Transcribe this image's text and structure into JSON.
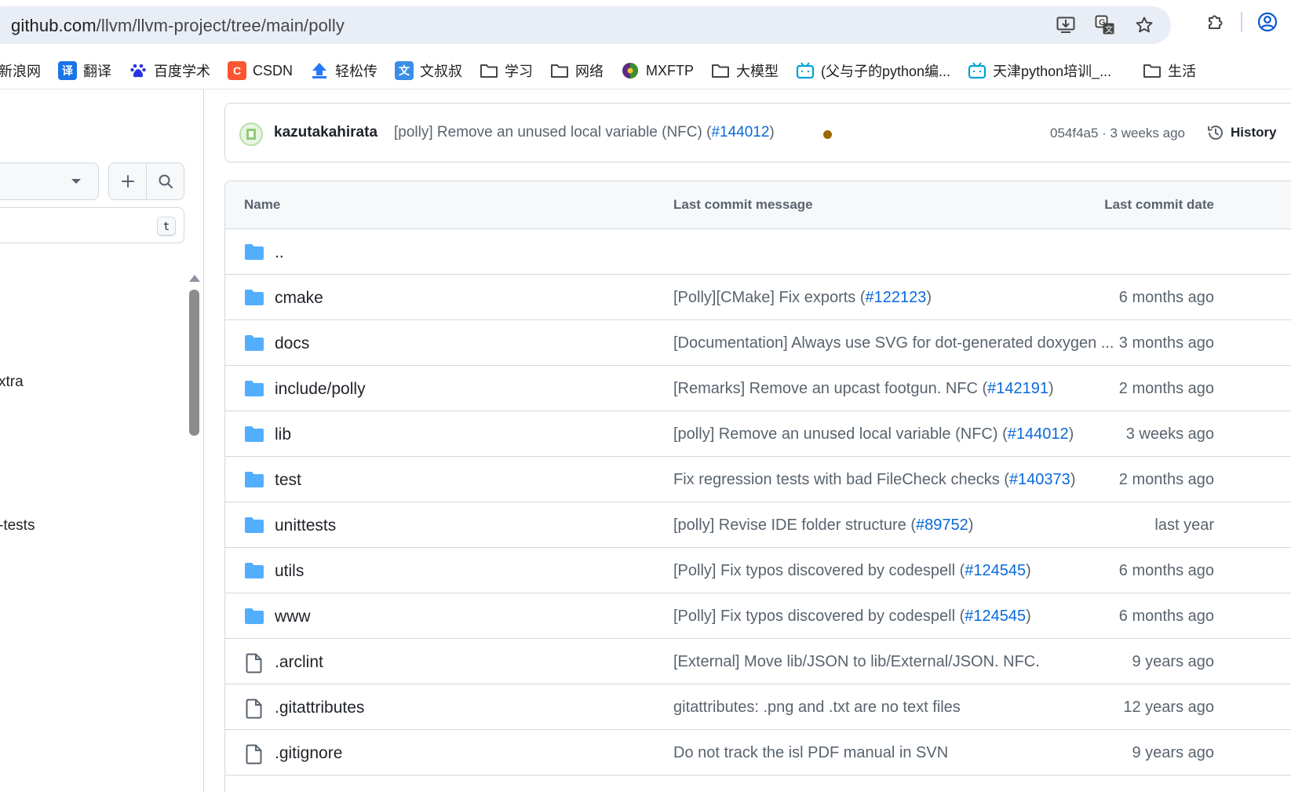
{
  "browser": {
    "url_host": "github.com",
    "url_path": "/llvm/llvm-project/tree/main/polly",
    "bookmarks": [
      {
        "label": "新浪网",
        "icon": "none"
      },
      {
        "label": "翻译",
        "icon": "translate-icon",
        "icon_text": "译",
        "color": "#1a73e8"
      },
      {
        "label": "百度学术",
        "icon": "baidu-paw-icon",
        "color": "#2932e1"
      },
      {
        "label": "CSDN",
        "icon": "csdn-icon",
        "icon_text": "C",
        "color": "#fc5531"
      },
      {
        "label": "轻松传",
        "icon": "upload-icon",
        "color": "#2878ff"
      },
      {
        "label": "文叔叔",
        "icon": "wenshushu-icon",
        "icon_text": "文",
        "color": "#3a8ee6"
      },
      {
        "label": "学习",
        "icon": "folder-icon"
      },
      {
        "label": "网络",
        "icon": "folder-icon"
      },
      {
        "label": "MXFTP",
        "icon": "mxftp-icon"
      },
      {
        "label": "大模型",
        "icon": "folder-icon"
      },
      {
        "label": "(父与子的python编...",
        "icon": "bilibili-icon",
        "color": "#00a1d6"
      },
      {
        "label": "天津python培训_...",
        "icon": "bilibili-icon",
        "color": "#00a1d6"
      },
      {
        "label": "生活",
        "icon": "folder-icon"
      }
    ]
  },
  "sidebar": {
    "filter_shortcut": "t",
    "tree_items": [
      {
        "label": "xtra"
      },
      {
        "label": "-tests"
      }
    ]
  },
  "latest_commit": {
    "author": "kazutakahirata",
    "message_prefix": "[polly] Remove an unused local variable (NFC) (",
    "pr": "#144012",
    "message_suffix": ")",
    "status_color": "#9a6700",
    "meta": "054f4a5 · 3 weeks ago",
    "history_label": "History"
  },
  "files": {
    "headers": {
      "name": "Name",
      "message": "Last commit message",
      "date": "Last commit date"
    },
    "rows": [
      {
        "name": "..",
        "type": "folder",
        "msg_prefix": "",
        "pr": "",
        "msg_suffix": "",
        "date": ""
      },
      {
        "name": "cmake",
        "type": "folder",
        "msg_prefix": "[Polly][CMake] Fix exports (",
        "pr": "#122123",
        "msg_suffix": ")",
        "date": "6 months ago"
      },
      {
        "name": "docs",
        "type": "folder",
        "msg_prefix": "[Documentation] Always use SVG for dot-generated doxygen ...",
        "pr": "",
        "msg_suffix": "",
        "date": "3 months ago"
      },
      {
        "name": "include/polly",
        "type": "folder",
        "msg_prefix": "[Remarks] Remove an upcast footgun. NFC (",
        "pr": "#142191",
        "msg_suffix": ")",
        "date": "2 months ago"
      },
      {
        "name": "lib",
        "type": "folder",
        "msg_prefix": "[polly] Remove an unused local variable (NFC) (",
        "pr": "#144012",
        "msg_suffix": ")",
        "date": "3 weeks ago"
      },
      {
        "name": "test",
        "type": "folder",
        "msg_prefix": "Fix regression tests with bad FileCheck checks (",
        "pr": "#140373",
        "msg_suffix": ")",
        "date": "2 months ago"
      },
      {
        "name": "unittests",
        "type": "folder",
        "msg_prefix": "[polly] Revise IDE folder structure (",
        "pr": "#89752",
        "msg_suffix": ")",
        "date": "last year"
      },
      {
        "name": "utils",
        "type": "folder",
        "msg_prefix": "[Polly] Fix typos discovered by codespell (",
        "pr": "#124545",
        "msg_suffix": ")",
        "date": "6 months ago"
      },
      {
        "name": "www",
        "type": "folder",
        "msg_prefix": "[Polly] Fix typos discovered by codespell (",
        "pr": "#124545",
        "msg_suffix": ")",
        "date": "6 months ago"
      },
      {
        "name": ".arclint",
        "type": "file",
        "msg_prefix": "[External] Move lib/JSON to lib/External/JSON. NFC.",
        "pr": "",
        "msg_suffix": "",
        "date": "9 years ago"
      },
      {
        "name": ".gitattributes",
        "type": "file",
        "msg_prefix": "gitattributes: .png and .txt are no text files",
        "pr": "",
        "msg_suffix": "",
        "date": "12 years ago"
      },
      {
        "name": ".gitignore",
        "type": "file",
        "msg_prefix": "Do not track the isl PDF manual in SVN",
        "pr": "",
        "msg_suffix": "",
        "date": "9 years ago"
      }
    ]
  },
  "colors": {
    "folder": "#54aeff",
    "link": "#0969da",
    "muted_text": "#59636e"
  }
}
